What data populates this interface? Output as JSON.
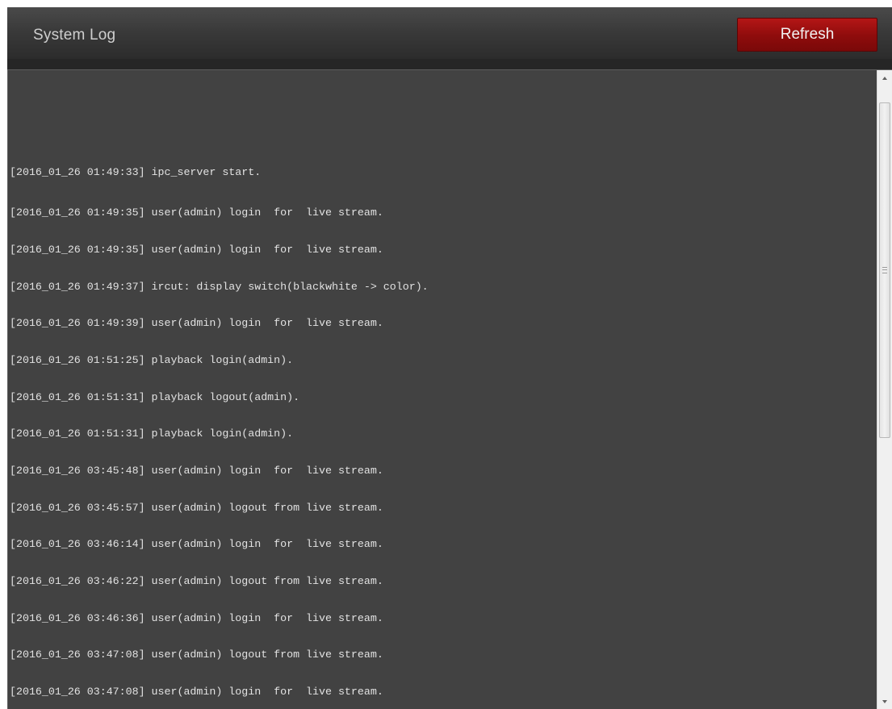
{
  "header": {
    "title": "System Log",
    "refresh_label": "Refresh"
  },
  "log": {
    "lines": [
      "[2016_01_26 01:49:33] ipc_server start.",
      "[2016_01_26 01:49:35] user(admin) login  for  live stream.",
      "[2016_01_26 01:49:35] user(admin) login  for  live stream.",
      "[2016_01_26 01:49:37] ircut: display switch(blackwhite -> color).",
      "[2016_01_26 01:49:39] user(admin) login  for  live stream.",
      "[2016_01_26 01:51:25] playback login(admin).",
      "[2016_01_26 01:51:31] playback logout(admin).",
      "[2016_01_26 01:51:31] playback login(admin).",
      "[2016_01_26 03:45:48] user(admin) login  for  live stream.",
      "[2016_01_26 03:45:57] user(admin) logout from live stream.",
      "[2016_01_26 03:46:14] user(admin) login  for  live stream.",
      "[2016_01_26 03:46:22] user(admin) logout from live stream.",
      "[2016_01_26 03:46:36] user(admin) login  for  live stream.",
      "[2016_01_26 03:47:08] user(admin) logout from live stream.",
      "[2016_01_26 03:47:08] user(admin) login  for  live stream."
    ]
  },
  "scrollbar": {
    "up_icon": "chevron-up-icon",
    "down_icon": "chevron-down-icon",
    "position_fraction": 0.05
  },
  "colors": {
    "header_bg": "#3a3a3a",
    "refresh_button": "#9a1010",
    "log_bg": "#424242",
    "log_text": "#e2e2e2",
    "title_text": "#cfcfcf"
  }
}
